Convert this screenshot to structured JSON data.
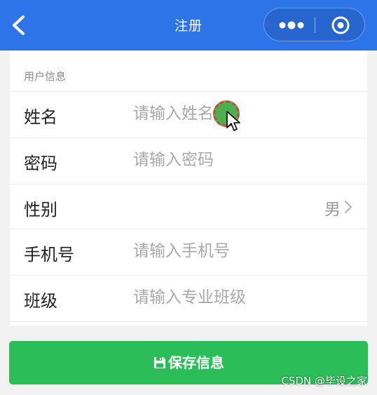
{
  "navbar": {
    "title": "注册",
    "background": "#2d74e8",
    "back_icon": "chevron-left-icon",
    "more_icon": "more-dots-icon",
    "close_icon": "target-circle-icon"
  },
  "form": {
    "section_label": "用户信息",
    "fields": [
      {
        "label": "姓名",
        "placeholder": "请输入姓名",
        "value": ""
      },
      {
        "label": "密码",
        "placeholder": "请输入密码",
        "value": ""
      },
      {
        "label": "性别",
        "selected": "男"
      },
      {
        "label": "手机号",
        "placeholder": "请输入手机号",
        "value": ""
      },
      {
        "label": "班级",
        "placeholder": "请输入专业班级",
        "value": ""
      }
    ]
  },
  "save_button": {
    "label": "保存信息",
    "icon": "save-disk-icon",
    "color": "#2bbd58"
  },
  "watermark": "CSDN @毕设之家"
}
